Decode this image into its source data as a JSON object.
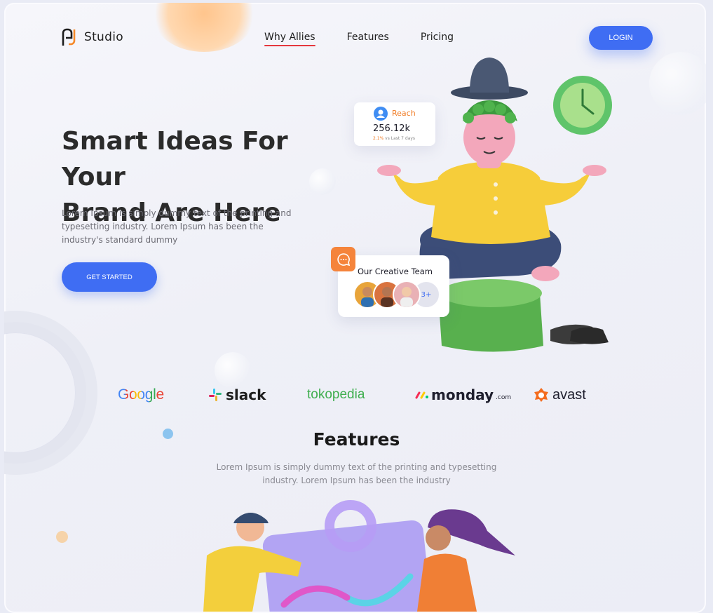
{
  "header": {
    "logo_text": "Studio",
    "nav": [
      "Why Allies",
      "Features",
      "Pricing"
    ],
    "active_nav": "Why Allies",
    "login_label": "LOGIN"
  },
  "hero": {
    "title_line1": "Smart Ideas For Your",
    "title_line2": "Brand Are Here",
    "description": "Lorem Ipsum is simply dummy text of the printing and typesetting industry. Lorem Ipsum has been the industry's standard dummy",
    "cta_label": "GET STARTED"
  },
  "reach_card": {
    "label": "Reach",
    "value": "256.12k",
    "change": "2.1%",
    "period": "vs Last 7 days"
  },
  "team_card": {
    "title": "Our Creative Team",
    "more": "3+"
  },
  "brands": {
    "google": "Google",
    "slack": "slack",
    "tokopedia": "tokopedia",
    "monday": "monday",
    "monday_suffix": ".com",
    "avast": "avast"
  },
  "features": {
    "title": "Features",
    "description": "Lorem Ipsum is simply dummy text of the printing and typesetting industry. Lorem Ipsum has been the industry"
  },
  "colors": {
    "primary": "#3f6df3",
    "accent_orange": "#f5843b",
    "nav_underline": "#e5373d"
  }
}
